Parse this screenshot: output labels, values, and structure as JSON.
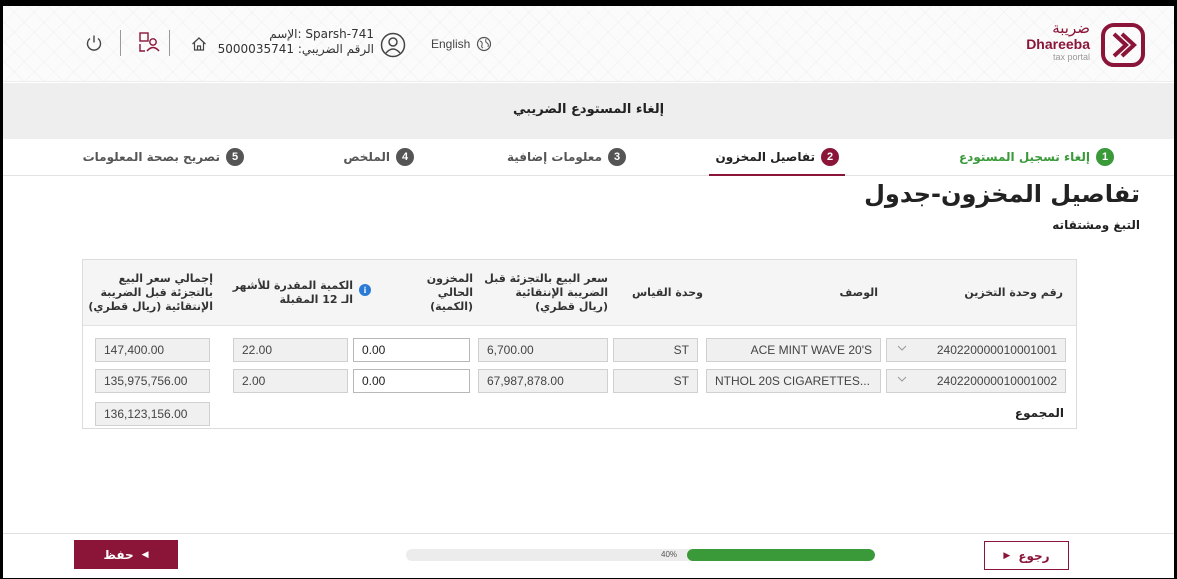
{
  "header": {
    "logo_ar": "ضريبة",
    "logo_en": "Dhareeba",
    "logo_sub": "tax portal",
    "language": "English",
    "user_name_line": "الإسم: Sparsh-741",
    "tax_number_line": "الرقم الضريبي: 5000035741",
    "icons": [
      "logo-icon",
      "globe-icon",
      "user-icon",
      "home-icon",
      "users-icon",
      "power-icon"
    ]
  },
  "title": "إلغاء المستودع الضريبي",
  "steps": [
    {
      "num": "1",
      "label": "إلغاء تسجيل المستودع",
      "state": "done"
    },
    {
      "num": "2",
      "label": "تفاصيل المخزون",
      "state": "active"
    },
    {
      "num": "3",
      "label": "معلومات إضافية",
      "state": "pending"
    },
    {
      "num": "4",
      "label": "الملخص",
      "state": "pending"
    },
    {
      "num": "5",
      "label": "تصريح بصحة المعلومات",
      "state": "pending"
    }
  ],
  "page_heading": "تفاصيل المخزون-جدول",
  "page_subheading": "التبغ ومشتقاته",
  "table": {
    "headers": {
      "sku": "رقم وحدة التخزين",
      "description": "الوصف",
      "uom": "وحدة القياس",
      "price": "سعر البيع بالتجزئة قبل الضريبة الإنتقائية (ريال قطري)",
      "current_stock": "المخزون الحالي (الكمية)",
      "estimated_qty": "الكمية المقدرة للأشهر الـ 12 المقبلة",
      "total_price": "إجمالي سعر البيع بالتجزئة قبل الضريبة الإنتقائية (ريال قطري)"
    },
    "rows": [
      {
        "sku": "240220000010001001",
        "description": "ACE MINT WAVE 20'S",
        "uom": "ST",
        "price": "6,700.00",
        "current_stock": "0.00",
        "estimated_qty": "22.00",
        "total_price": "147,400.00"
      },
      {
        "sku": "240220000010001002",
        "description": "...NTHOL 20S CIGARETTES",
        "uom": "ST",
        "price": "67,987,878.00",
        "current_stock": "0.00",
        "estimated_qty": "2.00",
        "total_price": "135,975,756.00"
      }
    ],
    "total_label": "المجموع",
    "total_value": "136,123,156.00"
  },
  "footer": {
    "save_label": "حفظ",
    "back_label": "رجوع",
    "progress_pct": 40,
    "progress_text": "40%"
  },
  "colors": {
    "brand": "#8a1538",
    "success": "#3a9a3a",
    "info": "#2b7bd6"
  }
}
